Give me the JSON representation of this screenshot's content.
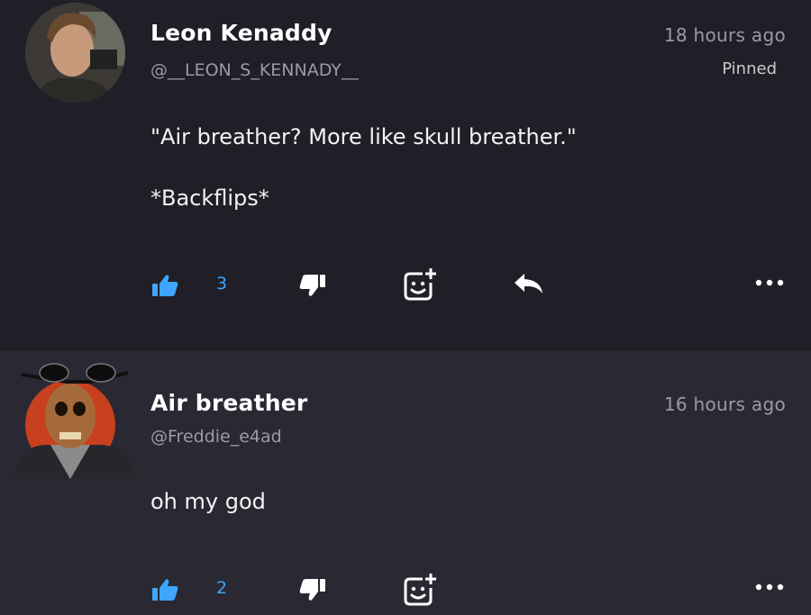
{
  "colors": {
    "accent": "#3ea6ff",
    "card_dark": "#201f27",
    "card_light": "#2a2933",
    "muted_text": "#9b9aa2"
  },
  "comments": [
    {
      "author": "Leon Kenaddy",
      "handle": "@__LEON_S_KENNADY__",
      "time": "18 hours ago",
      "badge": "Pinned",
      "lines": [
        "\"Air breather? More like skull breather.\"",
        "*Backflips*"
      ],
      "like_count": "3",
      "actions": [
        "thumbs-up-icon",
        "thumbs-down-icon",
        "add-reaction-icon",
        "reply-icon",
        "more-icon"
      ]
    },
    {
      "author": "Air breather",
      "handle": "@Freddie_e4ad",
      "time": "16 hours ago",
      "lines": [
        "oh my god"
      ],
      "like_count": "2",
      "actions": [
        "thumbs-up-icon",
        "thumbs-down-icon",
        "add-reaction-icon",
        "more-icon"
      ]
    }
  ]
}
